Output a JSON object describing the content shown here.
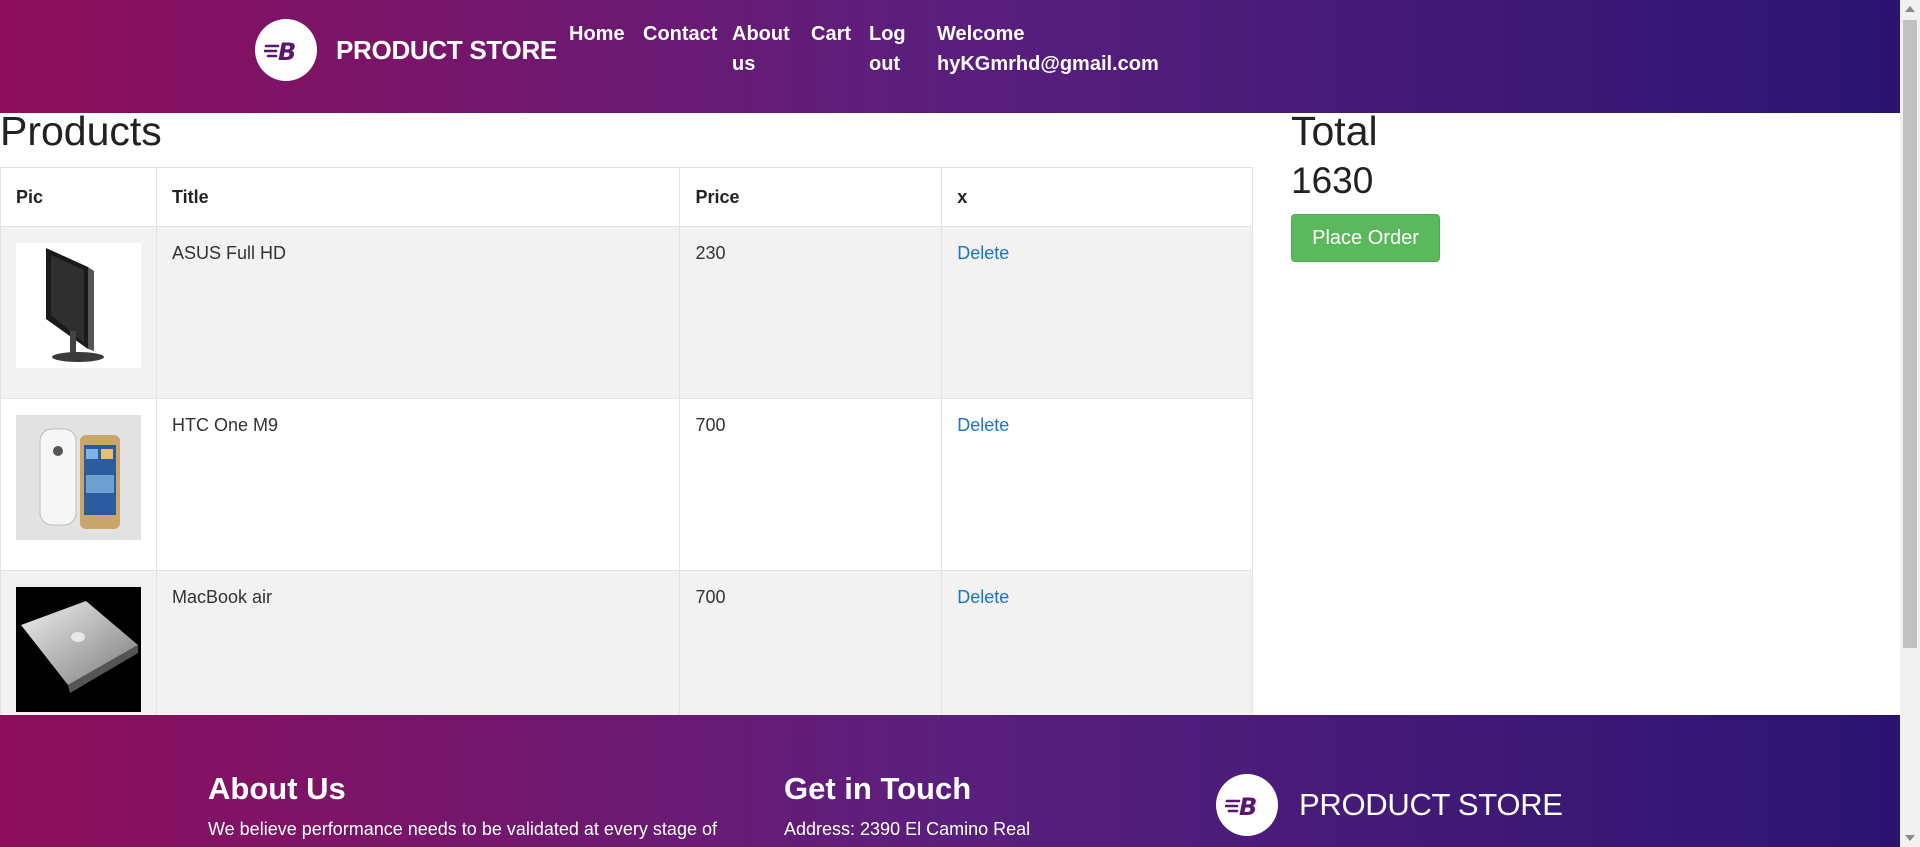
{
  "header": {
    "brand": "PRODUCT STORE",
    "nav": {
      "home": "Home",
      "contact": "Contact",
      "about": "About us",
      "cart": "Cart",
      "logout": "Log out",
      "welcome": "Welcome hyKGmrhd@gmail.com"
    }
  },
  "products": {
    "title": "Products",
    "columns": [
      "Pic",
      "Title",
      "Price",
      "x"
    ],
    "rows": [
      {
        "title": "ASUS Full HD",
        "price": "230",
        "action": "Delete",
        "image": "monitor-image"
      },
      {
        "title": "HTC One M9",
        "price": "700",
        "action": "Delete",
        "image": "phone-image"
      },
      {
        "title": "MacBook air",
        "price": "700",
        "action": "Delete",
        "image": "laptop-image"
      }
    ]
  },
  "summary": {
    "title": "Total",
    "value": "1630",
    "button": "Place Order"
  },
  "footer": {
    "about_title": "About Us",
    "about_text": "We believe performance needs to be validated at every stage of",
    "contact_title": "Get in Touch",
    "contact_text": "Address: 2390 El Camino Real",
    "brand": "PRODUCT STORE"
  },
  "colors": {
    "gradient_start": "#8e0e5b",
    "gradient_end": "#2a1470",
    "link": "#1e73c7",
    "success": "#5cb85c"
  }
}
